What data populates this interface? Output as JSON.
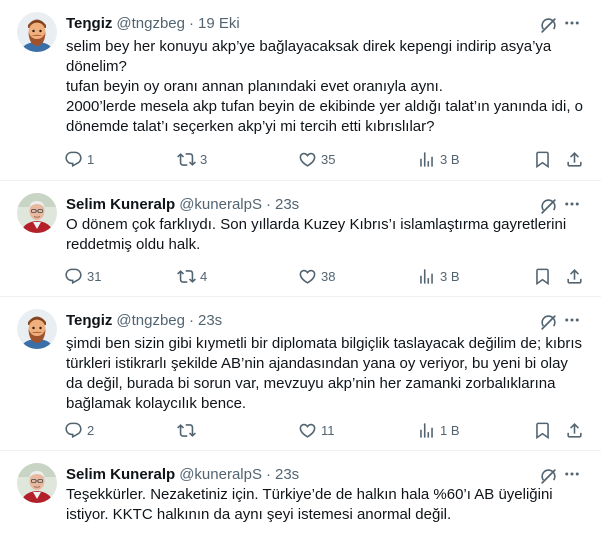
{
  "tweets": [
    {
      "author": "Teŋgiz",
      "handle": "@tngzbeg",
      "separator": "·",
      "time": "19 Eki",
      "text": "selim bey her konuyu akp’ye bağlayacaksak direk kepengi indirip asya’ya dönelim?\ntufan beyin oy oranı annan planındaki evet oranıyla aynı.\n2000’lerde mesela akp tufan beyin de ekibinde yer aldığı talat’ın yanında idi, o dönemde talat’ı seçerken akp’yi mi tercih etti kıbrıslılar?",
      "replies": "1",
      "reposts": "3",
      "likes": "35",
      "views": "3 B",
      "avatar_icon": "cartoon-bearded-man"
    },
    {
      "author": "Selim Kuneralp",
      "handle": "@kuneralpS",
      "separator": "·",
      "time": "23s",
      "text": "O dönem çok farklıydı. Son yıllarda Kuzey Kıbrıs’ı islamlaştırma gayretlerini reddetmiş oldu halk.",
      "replies": "31",
      "reposts": "4",
      "likes": "38",
      "views": "3 B",
      "avatar_icon": "man-portrait-photo"
    },
    {
      "author": "Teŋgiz",
      "handle": "@tngzbeg",
      "separator": "·",
      "time": "23s",
      "text": "şimdi ben sizin gibi kıymetli bir diplomata bilgiçlik taslayacak değilim de; kıbrıs türkleri istikrarlı şekilde AB’nin ajandasından yana oy veriyor, bu yeni bi olay da değil, burada bi sorun var, mevzuyu akp’nin her zamanki zorbalıklarına bağlamak kolaycılık bence.",
      "replies": "2",
      "reposts": "",
      "likes": "11",
      "views": "1 B",
      "avatar_icon": "cartoon-bearded-man"
    },
    {
      "author": "Selim Kuneralp",
      "handle": "@kuneralpS",
      "separator": "·",
      "time": "23s",
      "text": "Teşekkürler. Nezaketiniz için. Türkiye’de de halkın hala %60’ı AB üyeliğini istiyor. KKTC halkının da aynı şeyi istemesi anormal değil.",
      "avatar_icon": "man-portrait-photo"
    }
  ],
  "icons": {
    "grok": "grok-icon",
    "more": "more-dots-icon",
    "reply": "reply-bubble-icon",
    "repost": "repost-arrows-icon",
    "like": "heart-icon",
    "views": "views-bar-chart-icon",
    "bookmark": "bookmark-icon",
    "share": "share-upload-icon"
  },
  "colors": {
    "text": "#0f1419",
    "secondary": "#536471",
    "divider": "#eff3f4"
  }
}
